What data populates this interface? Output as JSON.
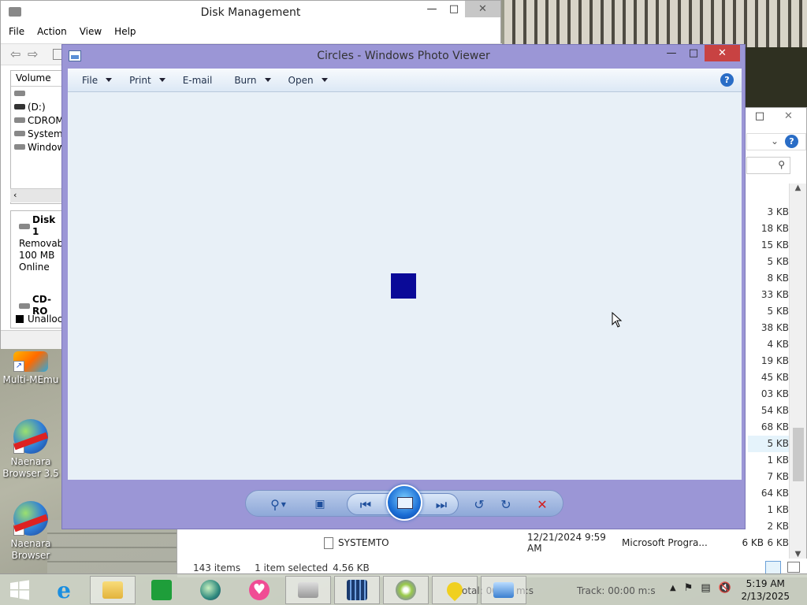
{
  "disk_management": {
    "title": "Disk Management",
    "menu": [
      "File",
      "Action",
      "View",
      "Help"
    ],
    "volume_header": "Volume",
    "volumes": [
      "",
      "(D:)",
      "CDROM",
      "System I",
      "Window"
    ],
    "disks": [
      {
        "name": "Disk 1",
        "lines": [
          "Removabl",
          "100 MB",
          "Online"
        ]
      },
      {
        "name": "CD-RO",
        "lines": []
      }
    ],
    "unallocated_label": "Unalloca"
  },
  "desktop": {
    "icons": [
      {
        "label": "Multi-MEmu"
      },
      {
        "label": "Naenara Browser 3.5"
      },
      {
        "label": "Naenara Browser"
      }
    ]
  },
  "photo_viewer": {
    "title": "Circles - Windows Photo Viewer",
    "menu": [
      {
        "label": "File",
        "dropdown": true
      },
      {
        "label": "Print",
        "dropdown": true
      },
      {
        "label": "E-mail",
        "dropdown": false
      },
      {
        "label": "Burn",
        "dropdown": true
      },
      {
        "label": "Open",
        "dropdown": true
      }
    ],
    "help_glyph": "?",
    "image_color": "#0a0a98",
    "canvas_color": "#e8f0f7",
    "frame_color": "#9b96d6",
    "controls": [
      "zoom-icon",
      "actual-size-icon",
      "previous-icon",
      "slideshow-icon",
      "next-icon",
      "rotate-ccw-icon",
      "rotate-cw-icon",
      "delete-icon"
    ]
  },
  "explorer": {
    "sizes": [
      "3 KB",
      "18 KB",
      "15 KB",
      "5 KB",
      "8 KB",
      "33 KB",
      "5 KB",
      "38 KB",
      "4 KB",
      "19 KB",
      "45 KB",
      "03 KB",
      "54 KB",
      "68 KB",
      "5 KB",
      "1 KB",
      "7 KB",
      "64 KB",
      "1 KB",
      "2 KB",
      "6 KB"
    ],
    "highlighted_size_index": 14,
    "file_row": {
      "name": "SYSTEMTO",
      "date": "12/21/2024 9:59 AM",
      "type": "Microsoft Progra...",
      "size": "6 KB"
    },
    "status": {
      "count": "143 items",
      "selected": "1 item selected",
      "selected_size": "4.56 KB"
    }
  },
  "taskbar": {
    "media_total": "otal: 00:00 m:s",
    "media_track": "Track: 00:00 m:s",
    "clock_time": "5:19 AM",
    "clock_date": "2/13/2025"
  }
}
